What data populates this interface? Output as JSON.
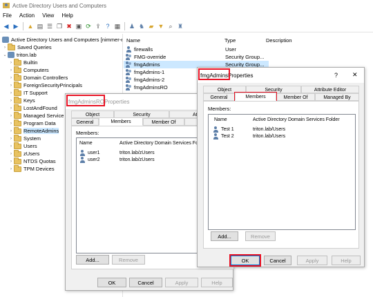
{
  "window": {
    "title": "Active Directory Users and Computers"
  },
  "menu": [
    "File",
    "Action",
    "View",
    "Help"
  ],
  "tree": {
    "root": "Active Directory Users and Computers [nimmer-es",
    "items": [
      {
        "label": "Saved Queries",
        "indent": 1,
        "expander": "›",
        "icon": "folder"
      },
      {
        "label": "triton.lab",
        "indent": 1,
        "expander": "⌄",
        "icon": "domain"
      },
      {
        "label": "Builtin",
        "indent": 2,
        "expander": "›",
        "icon": "folder"
      },
      {
        "label": "Computers",
        "indent": 2,
        "expander": "›",
        "icon": "folder"
      },
      {
        "label": "Domain Controllers",
        "indent": 2,
        "expander": "›",
        "icon": "folder"
      },
      {
        "label": "ForeignSecurityPrincipals",
        "indent": 2,
        "expander": "›",
        "icon": "folder"
      },
      {
        "label": "IT Support",
        "indent": 2,
        "expander": "›",
        "icon": "folder"
      },
      {
        "label": "Keys",
        "indent": 2,
        "expander": "›",
        "icon": "folder"
      },
      {
        "label": "LostAndFound",
        "indent": 2,
        "expander": "›",
        "icon": "folder"
      },
      {
        "label": "Managed Service",
        "indent": 2,
        "expander": "›",
        "icon": "folder"
      },
      {
        "label": "Program Data",
        "indent": 2,
        "expander": "›",
        "icon": "folder"
      },
      {
        "label": "RemoteAdmins",
        "indent": 2,
        "expander": "›",
        "icon": "folder",
        "selected": true
      },
      {
        "label": "System",
        "indent": 2,
        "expander": "›",
        "icon": "folder"
      },
      {
        "label": "Users",
        "indent": 2,
        "expander": "›",
        "icon": "folder"
      },
      {
        "label": "zUsers",
        "indent": 2,
        "expander": "›",
        "icon": "folder"
      },
      {
        "label": "NTDS Quotas",
        "indent": 2,
        "expander": "›",
        "icon": "folder"
      },
      {
        "label": "TPM Devices",
        "indent": 2,
        "expander": "›",
        "icon": "folder"
      }
    ]
  },
  "list": {
    "headers": [
      "Name",
      "Type",
      "Description"
    ],
    "rows": [
      {
        "name": "firewalls",
        "type": "User",
        "icon": "user"
      },
      {
        "name": "FMG-override",
        "type": "Security Group...",
        "icon": "group"
      },
      {
        "name": "fmgAdmins",
        "type": "Security Group...",
        "icon": "group",
        "selected": true
      },
      {
        "name": "fmgAdmins-1",
        "type": "",
        "icon": "group"
      },
      {
        "name": "fmgAdmins-2",
        "type": "",
        "icon": "group"
      },
      {
        "name": "fmgAdminsRO",
        "type": "",
        "icon": "group"
      }
    ]
  },
  "dialog_ro": {
    "title_highlight": "fmgAdminsRO",
    "title_rest": " Properties",
    "tabs_top": [
      "Object",
      "Security",
      "Attribute"
    ],
    "tabs_bottom": [
      "General",
      "Members",
      "Member Of",
      "Man"
    ],
    "members_label": "Members:",
    "col_name": "Name",
    "col_folder": "Active Directory Domain Services Folder",
    "members": [
      {
        "name": "user1",
        "folder": "triton.lab/zUsers"
      },
      {
        "name": "user2",
        "folder": "triton.lab/zUsers"
      }
    ],
    "add": "Add...",
    "remove": "Remove",
    "ok": "OK",
    "cancel": "Cancel",
    "apply": "Apply",
    "help": "Help"
  },
  "dialog_admins": {
    "title_highlight": "fmgAdmins",
    "title_rest": " Properties",
    "question": "?",
    "close": "✕",
    "tabs_top": [
      "Object",
      "Security",
      "Attribute Editor"
    ],
    "tabs_bottom": [
      "General",
      "Members",
      "Member Of",
      "Managed By"
    ],
    "members_label": "Members:",
    "col_name": "Name",
    "col_folder": "Active Directory Domain Services Folder",
    "members": [
      {
        "name": "Test 1",
        "folder": "triton.lab/Users"
      },
      {
        "name": "Test 2",
        "folder": "triton.lab/Users"
      }
    ],
    "add": "Add...",
    "remove": "Remove",
    "ok": "OK",
    "cancel": "Cancel",
    "apply": "Apply",
    "help": "Help"
  },
  "colors": {
    "highlight": "#e81123",
    "selection": "#cce8ff",
    "accent": "#0078d7"
  }
}
